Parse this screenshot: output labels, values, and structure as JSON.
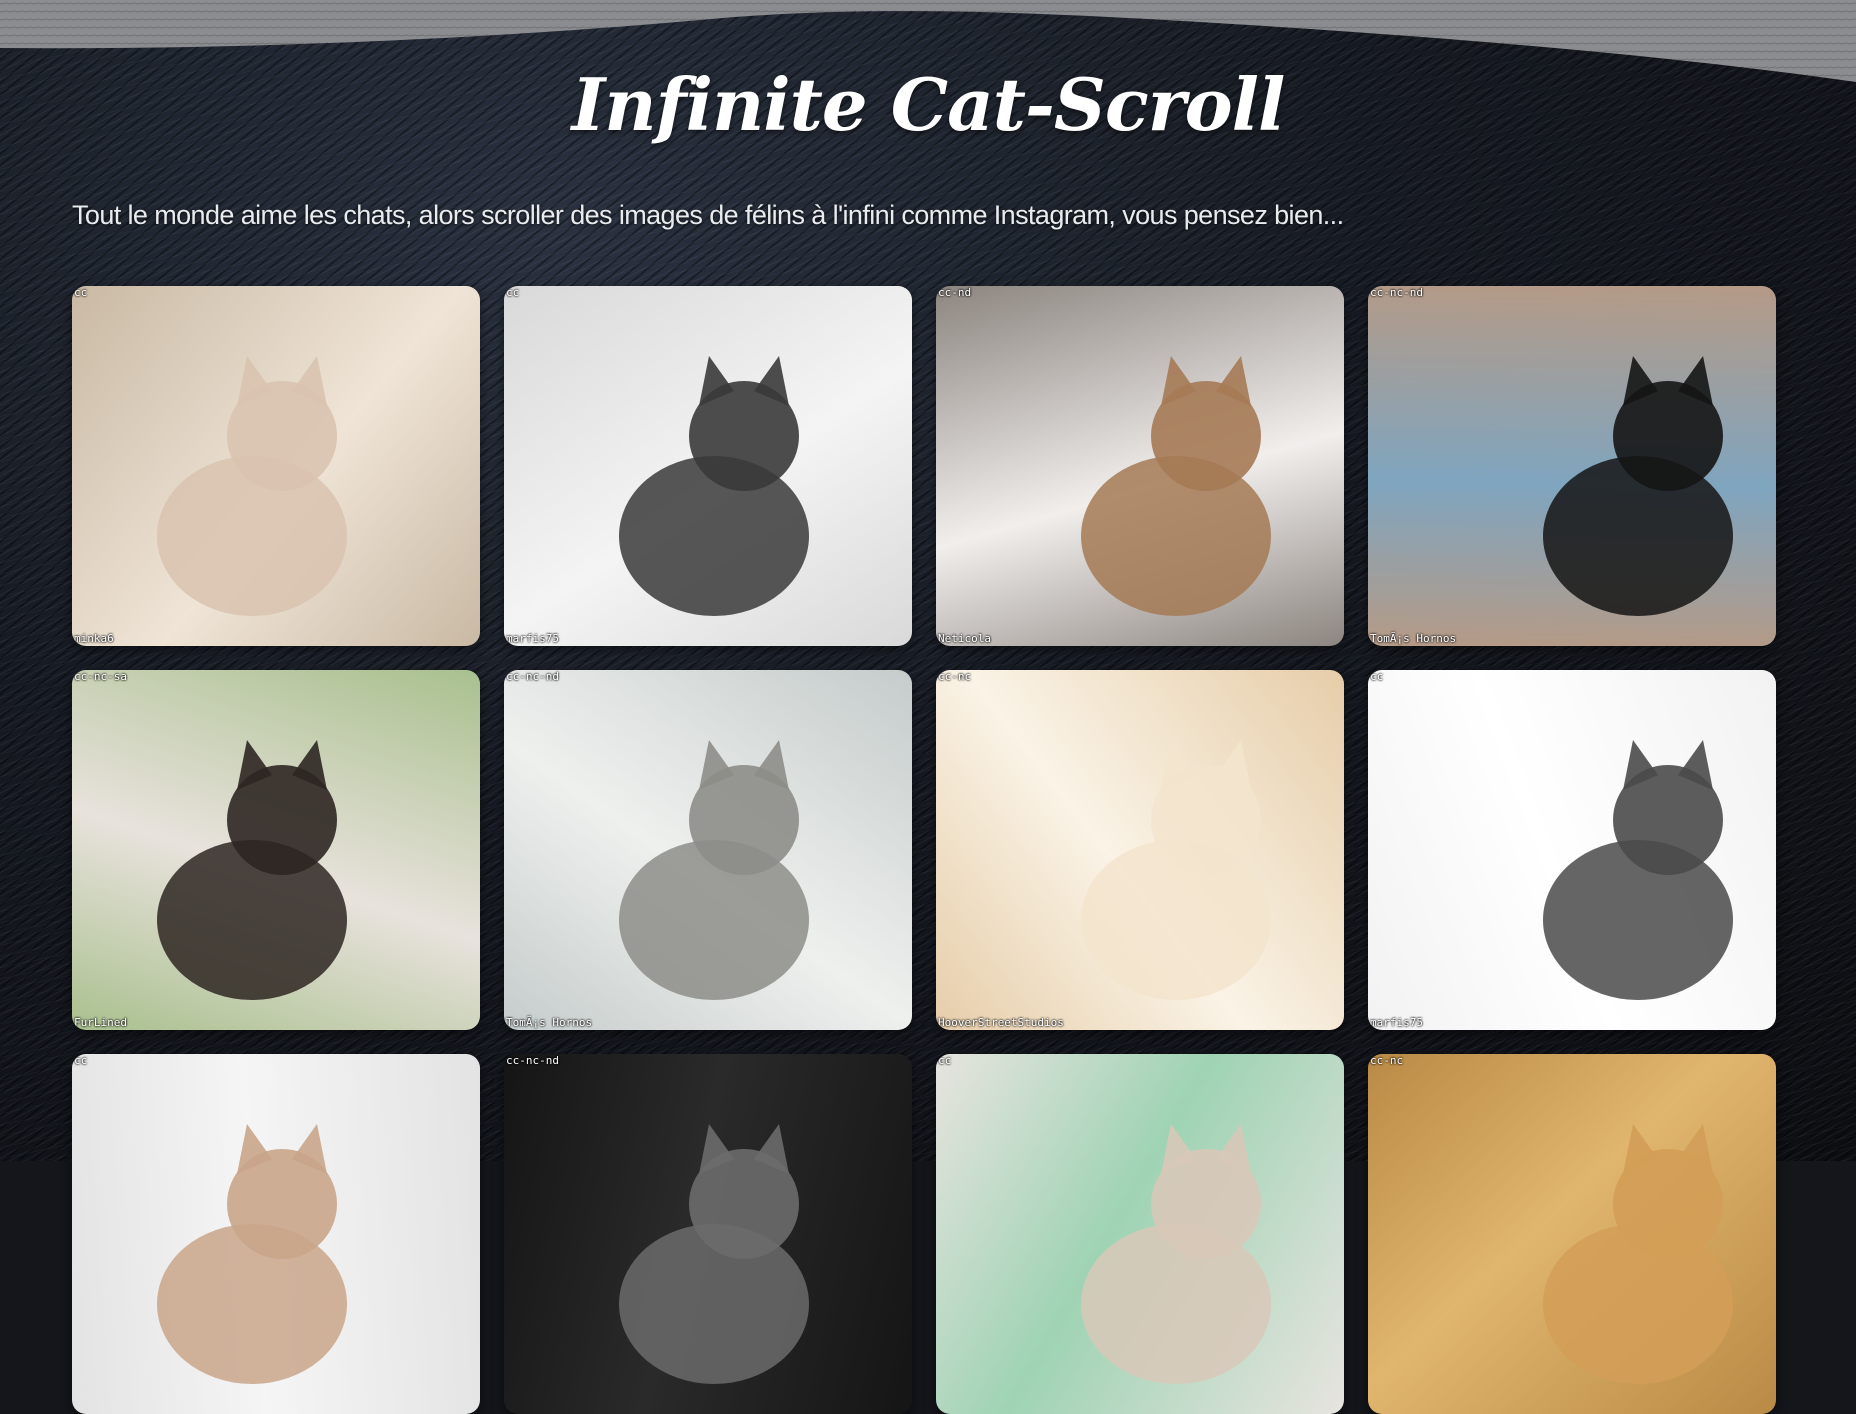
{
  "page": {
    "title": "Infinite Cat-Scroll",
    "subtitle": "Tout le monde aime les chats, alors scroller des images de félins à l'infini comme Instagram, vous pensez bien..."
  },
  "colors": {
    "background": "#14161b",
    "title": "#ffffff",
    "subtitle": "#e9ecef"
  },
  "cards": [
    {
      "license": "cc",
      "author": "minka6",
      "bg": "#c9b9a4",
      "accent": "#efe4d6",
      "cat": "#d9c3b0"
    },
    {
      "license": "cc",
      "author": "marfis75",
      "bg": "#d9d9d9",
      "accent": "#f4f4f4",
      "cat": "#3a3a3a"
    },
    {
      "license": "cc-nd",
      "author": "Neticola",
      "bg": "#8c8580",
      "accent": "#f1eeec",
      "cat": "#a57a55"
    },
    {
      "license": "cc-nc-nd",
      "author": "TomÃ¡s Hornos",
      "bg": "#b59a86",
      "accent": "#7fa5bf",
      "cat": "#151515"
    },
    {
      "license": "cc-nc-sa",
      "author": "FurLined",
      "bg": "#a9c08e",
      "accent": "#e8e2dc",
      "cat": "#2e2622"
    },
    {
      "license": "cc-nc-nd",
      "author": "TomÃ¡s Hornos",
      "bg": "#c5cccb",
      "accent": "#eef0ee",
      "cat": "#8d8d88"
    },
    {
      "license": "cc-nc",
      "author": "HooverStreetStudios",
      "bg": "#e6cda9",
      "accent": "#faf3e6",
      "cat": "#f3e4cd"
    },
    {
      "license": "cc",
      "author": "marfis75",
      "bg": "#f2f2f2",
      "accent": "#ffffff",
      "cat": "#4a4a4a"
    },
    {
      "license": "cc",
      "author": "",
      "bg": "#e3e3e3",
      "accent": "#f5f5f5",
      "cat": "#c9a58a"
    },
    {
      "license": "cc-nc-nd",
      "author": "",
      "bg": "#151515",
      "accent": "#2a2a2a",
      "cat": "#6b6b6b"
    },
    {
      "license": "cc",
      "author": "",
      "bg": "#e7e4df",
      "accent": "#9fd3b4",
      "cat": "#d8c8b8"
    },
    {
      "license": "cc-nc",
      "author": "",
      "bg": "#b98a45",
      "accent": "#e0b56e",
      "cat": "#d39d57"
    }
  ]
}
